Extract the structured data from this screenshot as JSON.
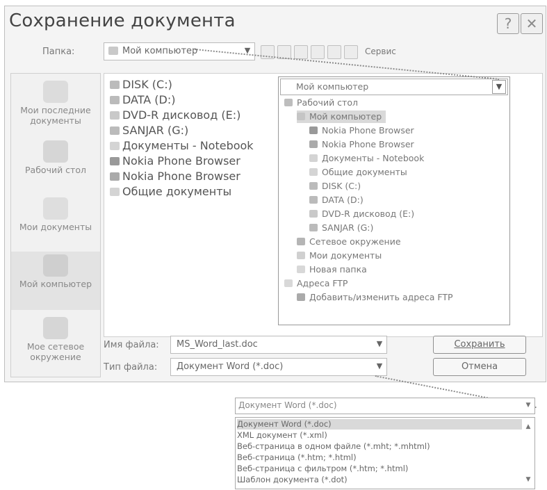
{
  "dialog": {
    "title": "Сохранение документа",
    "help_label": "?",
    "close_label": "✕",
    "folder_label": "Папка:",
    "folder_value": "Мой компьютер",
    "tools_label": "Сервис"
  },
  "places": [
    {
      "label": "Мои последние документы"
    },
    {
      "label": "Рабочий стол"
    },
    {
      "label": "Мои документы"
    },
    {
      "label": "Мой компьютер"
    },
    {
      "label": "Мое сетевое окружение"
    }
  ],
  "files": [
    "DISK (C:)",
    "DATA (D:)",
    "DVD-R дисковод (E:)",
    "SANJAR (G:)",
    "Документы - Notebook",
    "Nokia Phone Browser",
    "Nokia Phone Browser",
    "Общие документы"
  ],
  "folder_dropdown": {
    "current": "Мой компьютер",
    "items": [
      "Рабочий стол",
      "Мой компьютер",
      "Nokia Phone Browser",
      "Nokia Phone Browser",
      "Документы - Notebook",
      "Общие документы",
      "DISK (C:)",
      "DATA (D:)",
      "DVD-R дисковод (E:)",
      "SANJAR (G:)",
      "Сетевое окружение",
      "Мои документы",
      "Новая папка",
      "Адреса FTP",
      "Добавить/изменить адреса FTP"
    ]
  },
  "filename": {
    "label": "Имя файла:",
    "value": "MS_Word_last.doc"
  },
  "filetype": {
    "label": "Тип файла:",
    "value": "Документ Word (*.doc)"
  },
  "buttons": {
    "save": "Сохранить",
    "cancel": "Отмена"
  },
  "filetype_dropdown": {
    "current": "Документ Word (*.doc)",
    "items": [
      "Документ Word (*.doc)",
      "XML документ (*.xml)",
      "Веб-страница в одном файле (*.mht; *.mhtml)",
      "Веб-страница (*.htm; *.html)",
      "Веб-страница с фильтром (*.htm; *.html)",
      "Шаблон документа (*.dot)"
    ]
  }
}
